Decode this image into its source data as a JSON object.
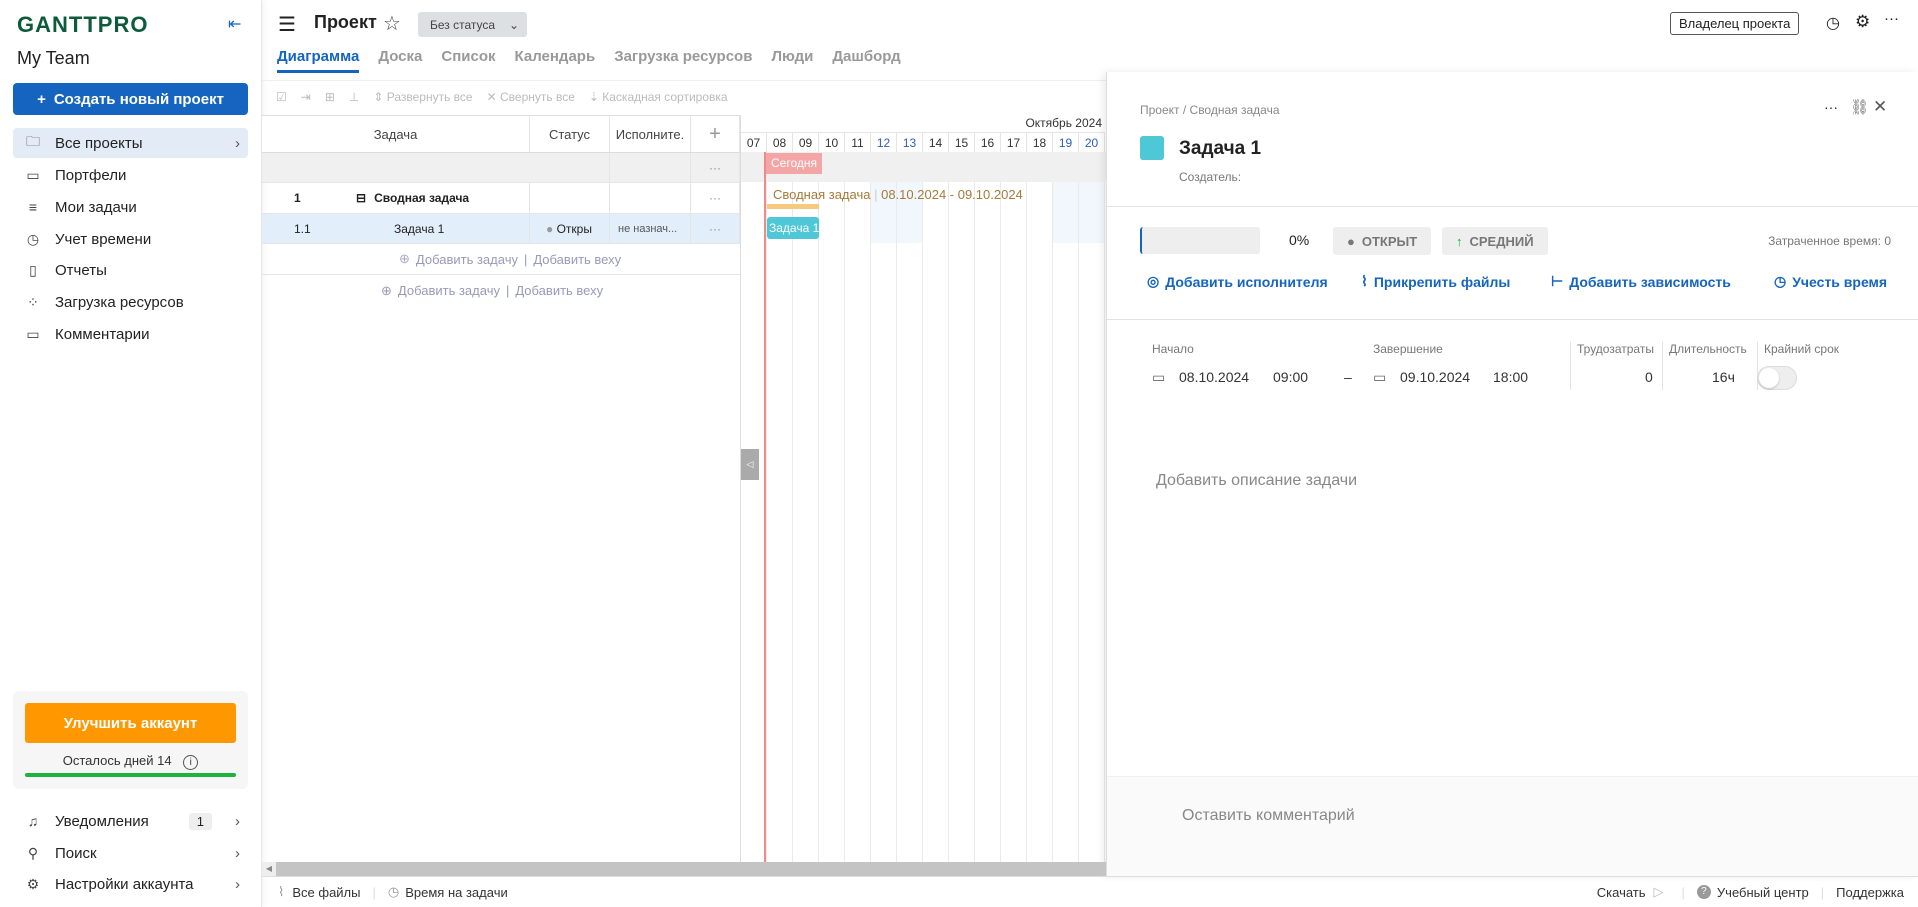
{
  "sidebar": {
    "logo": "GANTTPRO",
    "team": "My Team",
    "create_label": "Создать новый проект",
    "items": [
      {
        "label": "Все проекты",
        "icon": "folder-icon"
      },
      {
        "label": "Портфели",
        "icon": "briefcase-icon"
      },
      {
        "label": "Мои задачи",
        "icon": "list-icon"
      },
      {
        "label": "Учет времени",
        "icon": "clock-icon"
      },
      {
        "label": "Отчеты",
        "icon": "report-icon"
      },
      {
        "label": "Загрузка ресурсов",
        "icon": "grid-icon"
      },
      {
        "label": "Комментарии",
        "icon": "comment-icon"
      }
    ],
    "upgrade_label": "Улучшить аккаунт",
    "days_left": "Осталось дней 14",
    "trial_progress": 1.0,
    "bottom": [
      {
        "label": "Уведомления",
        "badge": "1"
      },
      {
        "label": "Поиск"
      },
      {
        "label": "Настройки аккаунта"
      }
    ]
  },
  "header": {
    "title": "Проект",
    "status": "Без статуса",
    "owner": "Владелец проекта",
    "tabs": [
      "Диаграмма",
      "Доска",
      "Список",
      "Календарь",
      "Загрузка ресурсов",
      "Люди",
      "Дашборд"
    ],
    "active_tab": 0
  },
  "toolbar": {
    "expand": "Развернуть все",
    "collapse": "Свернуть все",
    "sort": "Каскадная сортировка"
  },
  "grid": {
    "columns": [
      "Задача",
      "Статус",
      "Исполните."
    ],
    "rows": [
      {
        "num": "1",
        "name": "Сводная задача",
        "status": "",
        "assignee": ""
      },
      {
        "num": "1.1",
        "name": "Задача 1",
        "status": "Откры",
        "assignee": "не назнач..."
      }
    ],
    "add_task": "Добавить задачу",
    "add_milestone": "Добавить веху"
  },
  "gantt": {
    "month": "Октябрь 2024",
    "days": [
      "07",
      "08",
      "09",
      "10",
      "11",
      "12",
      "13",
      "14",
      "15",
      "16",
      "17",
      "18",
      "19",
      "20"
    ],
    "weekends": [
      "12",
      "13",
      "19",
      "20"
    ],
    "today": "Сегодня",
    "summary_label": "Сводная задача",
    "summary_dates": "08.10.2024 - 09.10.2024",
    "task_label": "Задача 1",
    "colors": {
      "today": "#f4a6a6",
      "summary": "#f5c97e",
      "task": "#4ec7d6"
    }
  },
  "panel": {
    "breadcrumb": "Проект / Сводная задача",
    "title": "Задача 1",
    "creator": "Создатель:",
    "progress": "0%",
    "status": "ОТКРЫТ",
    "priority": "СРЕДНИЙ",
    "time_spent": "Затраченное время: 0",
    "actions": [
      "Добавить исполнителя",
      "Прикрепить файлы",
      "Добавить зависимость",
      "Учесть время"
    ],
    "labels": {
      "start": "Начало",
      "end": "Завершение",
      "effort": "Трудозатраты",
      "duration": "Длительность",
      "deadline": "Крайний срок"
    },
    "start_date": "08.10.2024",
    "start_time": "09:00",
    "end_date": "09.10.2024",
    "end_time": "18:00",
    "effort": "0",
    "duration": "16ч",
    "deadline_enabled": false,
    "description_placeholder": "Добавить описание задачи",
    "comment_placeholder": "Оставить комментарий"
  },
  "footer": {
    "files": "Все файлы",
    "time": "Время на задачи",
    "download": "Скачать",
    "learning": "Учебный центр",
    "support": "Поддержка"
  }
}
